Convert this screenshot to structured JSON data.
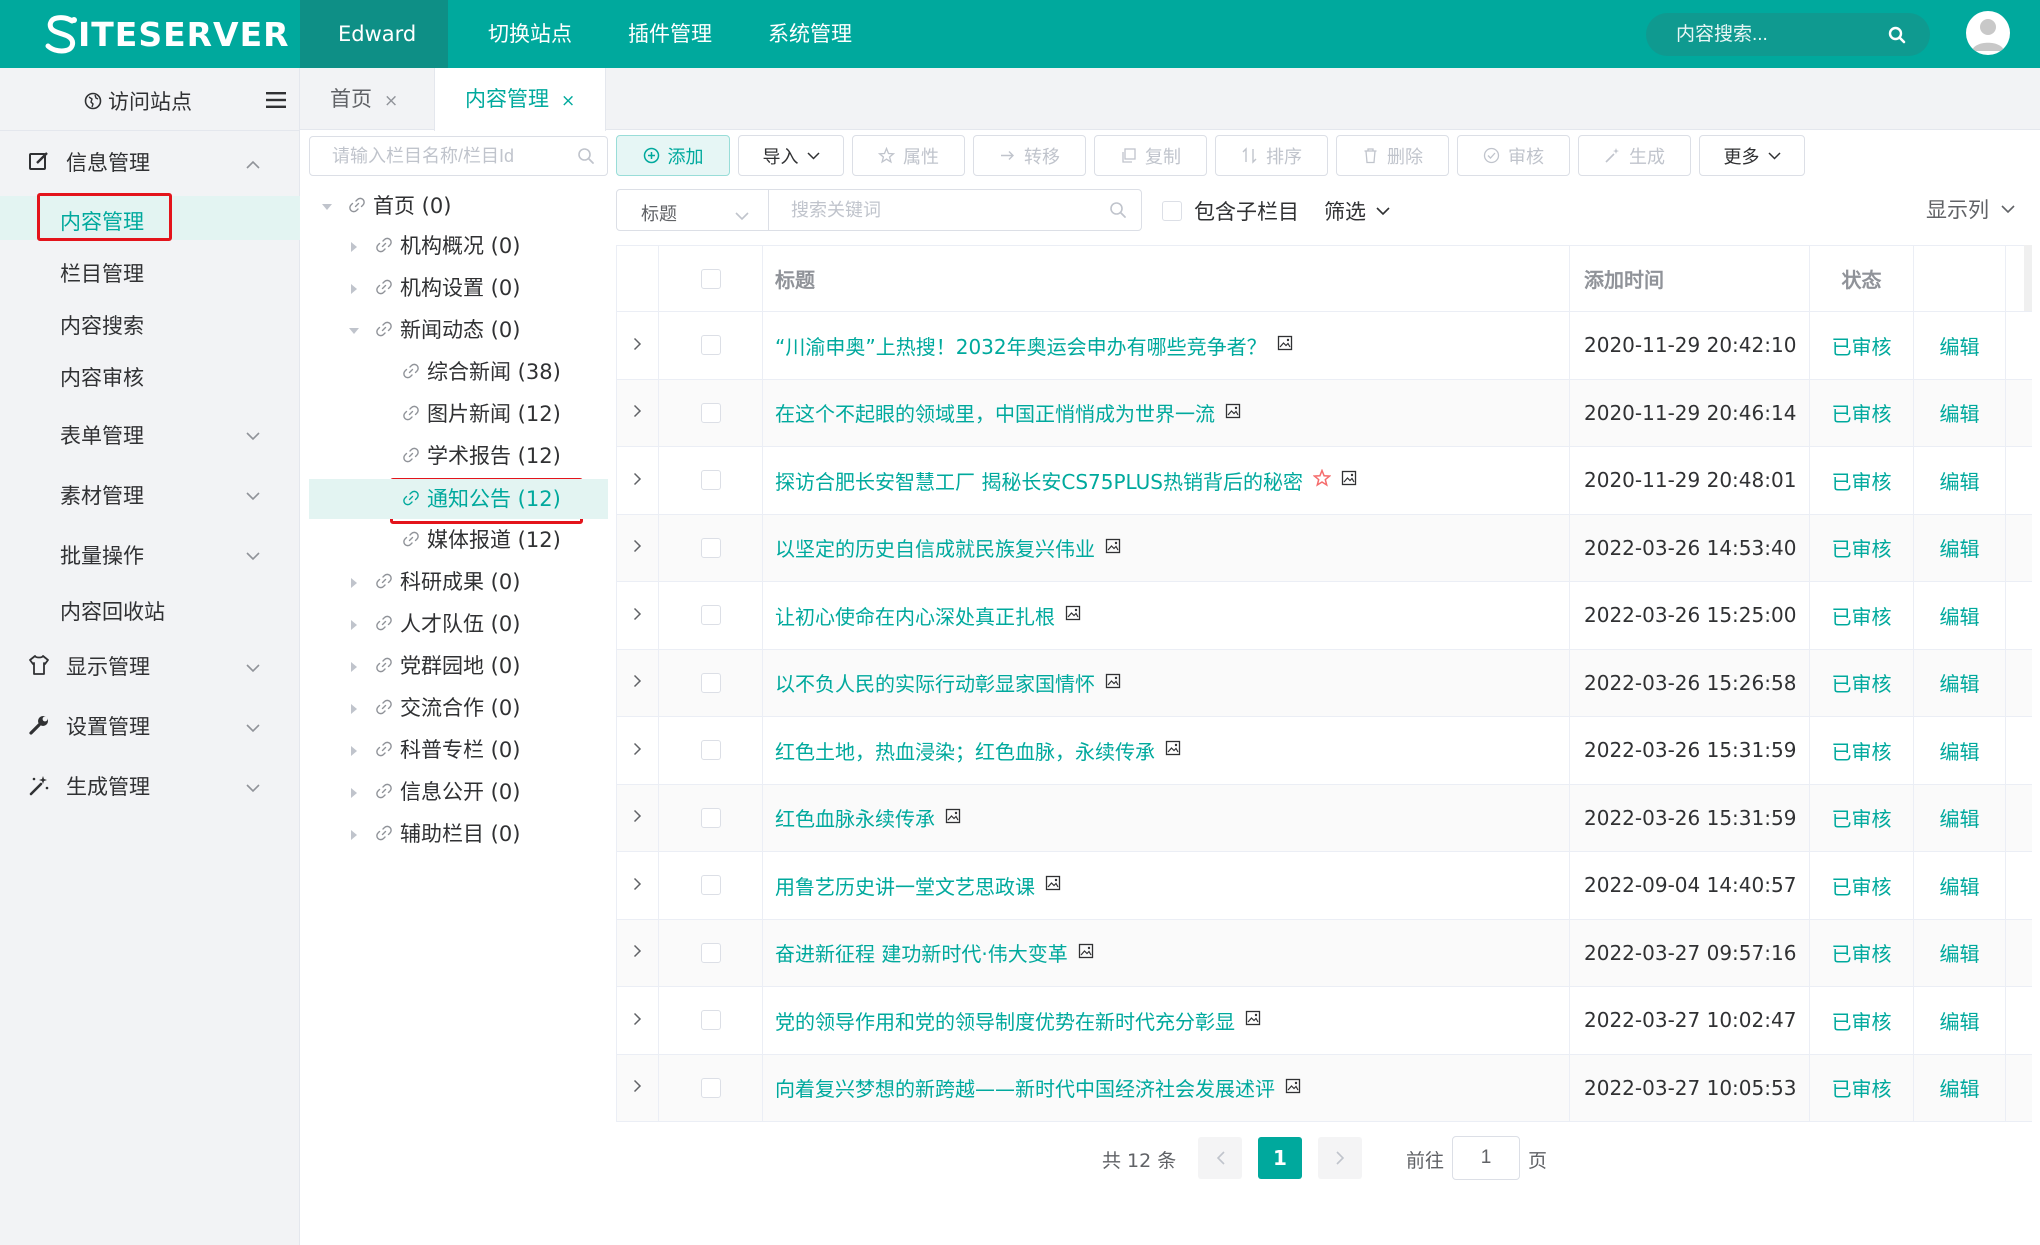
{
  "brand": {
    "logo_text": "ITESERVER"
  },
  "topnav": {
    "items": [
      "Edward",
      "切换站点",
      "插件管理",
      "系统管理"
    ],
    "search_placeholder": "内容搜索..."
  },
  "sidebar": {
    "visit_label": "访问站点",
    "groups": [
      {
        "label": "信息管理",
        "icon": "edit-icon"
      },
      {
        "label": "显示管理",
        "icon": "tshirt-icon"
      },
      {
        "label": "设置管理",
        "icon": "wrench-icon"
      },
      {
        "label": "生成管理",
        "icon": "magic-wand-icon"
      }
    ],
    "info_items": [
      "内容管理",
      "栏目管理",
      "内容搜索",
      "内容审核",
      "表单管理",
      "素材管理",
      "批量操作",
      "内容回收站"
    ]
  },
  "tabs": [
    {
      "label": "首页",
      "close": "×"
    },
    {
      "label": "内容管理",
      "close": "×"
    }
  ],
  "tree": {
    "search_placeholder": "请输入栏目名称/栏目Id",
    "nodes": [
      "首页 (0)",
      "机构概况 (0)",
      "机构设置 (0)",
      "新闻动态 (0)",
      "综合新闻 (38)",
      "图片新闻 (12)",
      "学术报告 (12)",
      "通知公告 (12)",
      "媒体报道 (12)",
      "科研成果 (0)",
      "人才队伍 (0)",
      "党群园地 (0)",
      "交流合作 (0)",
      "科普专栏 (0)",
      "信息公开 (0)",
      "辅助栏目 (0)"
    ]
  },
  "toolbar": {
    "add": "添加",
    "import": "导入",
    "attributes": "属性",
    "transfer": "转移",
    "copy": "复制",
    "sort": "排序",
    "delete": "删除",
    "review": "审核",
    "generate": "生成",
    "more": "更多"
  },
  "filter": {
    "field": "标题",
    "keyword_placeholder": "搜索关键词",
    "include_sub": "包含子栏目",
    "filter_label": "筛选",
    "columns_label": "显示列"
  },
  "table": {
    "headers": {
      "title": "标题",
      "time": "添加时间",
      "status": "状态"
    },
    "rows": [
      {
        "title": "“川渝申奥”上热搜！2032年奥运会申办有哪些竞争者？",
        "time": "2020-11-29 20:42:10",
        "status": "已审核",
        "action": "编辑",
        "star": false
      },
      {
        "title": "在这个不起眼的领域里，中国正悄悄成为世界一流",
        "time": "2020-11-29 20:46:14",
        "status": "已审核",
        "action": "编辑",
        "star": false
      },
      {
        "title": "探访合肥长安智慧工厂 揭秘长安CS75PLUS热销背后的秘密",
        "time": "2020-11-29 20:48:01",
        "status": "已审核",
        "action": "编辑",
        "star": true
      },
      {
        "title": "以坚定的历史自信成就民族复兴伟业",
        "time": "2022-03-26 14:53:40",
        "status": "已审核",
        "action": "编辑",
        "star": false
      },
      {
        "title": "让初心使命在内心深处真正扎根",
        "time": "2022-03-26 15:25:00",
        "status": "已审核",
        "action": "编辑",
        "star": false
      },
      {
        "title": "以不负人民的实际行动彰显家国情怀",
        "time": "2022-03-26 15:26:58",
        "status": "已审核",
        "action": "编辑",
        "star": false
      },
      {
        "title": "红色土地，热血浸染；红色血脉，永续传承",
        "time": "2022-03-26 15:31:59",
        "status": "已审核",
        "action": "编辑",
        "star": false
      },
      {
        "title": "红色血脉永续传承",
        "time": "2022-03-26 15:31:59",
        "status": "已审核",
        "action": "编辑",
        "star": false
      },
      {
        "title": "用鲁艺历史讲一堂文艺思政课",
        "time": "2022-09-04 14:40:57",
        "status": "已审核",
        "action": "编辑",
        "star": false
      },
      {
        "title": "奋进新征程 建功新时代·伟大变革",
        "time": "2022-03-27 09:57:16",
        "status": "已审核",
        "action": "编辑",
        "star": false
      },
      {
        "title": "党的领导作用和党的领导制度优势在新时代充分彰显",
        "time": "2022-03-27 10:02:47",
        "status": "已审核",
        "action": "编辑",
        "star": false
      },
      {
        "title": "向着复兴梦想的新跨越——新时代中国经济社会发展述评",
        "time": "2022-03-27 10:05:53",
        "status": "已审核",
        "action": "编辑",
        "star": false
      }
    ]
  },
  "pagination": {
    "total": "共 12 条",
    "current": "1",
    "goto_label": "前往",
    "goto_value": "1",
    "goto_suffix": "页"
  },
  "colors": {
    "accent": "#00a99d",
    "highlight_box": "#e3141b"
  }
}
